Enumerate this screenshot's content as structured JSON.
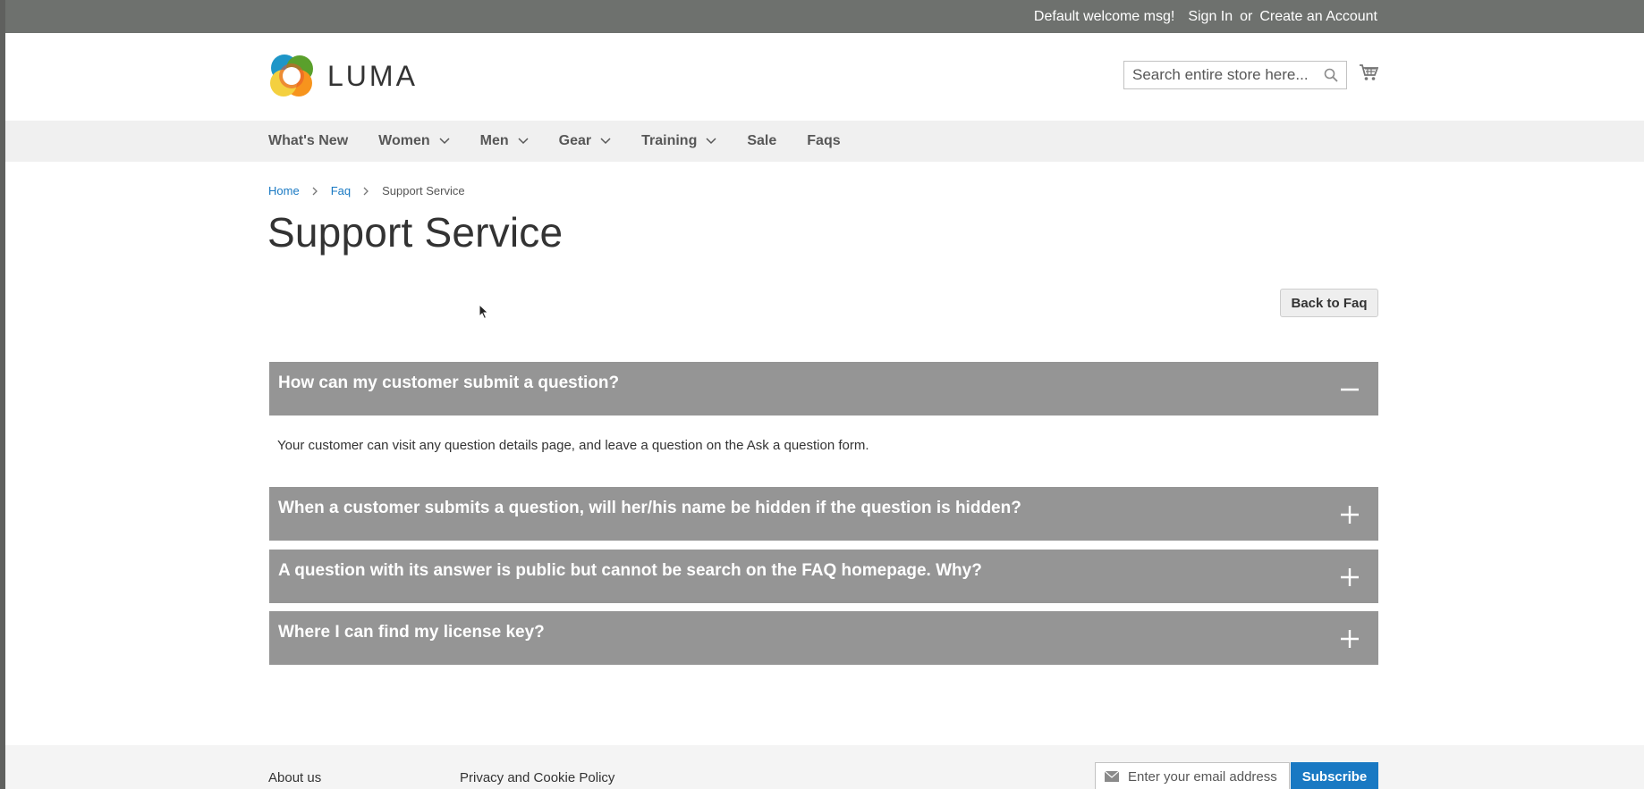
{
  "top_panel": {
    "welcome": "Default welcome msg!",
    "sign_in": "Sign In",
    "or": "or",
    "create_account": "Create an Account"
  },
  "header": {
    "logo_text": "LUMA",
    "search_placeholder": "Search entire store here...",
    "search_value": ""
  },
  "nav": {
    "items": [
      {
        "label": "What's New",
        "has_dropdown": false
      },
      {
        "label": "Women",
        "has_dropdown": true
      },
      {
        "label": "Men",
        "has_dropdown": true
      },
      {
        "label": "Gear",
        "has_dropdown": true
      },
      {
        "label": "Training",
        "has_dropdown": true
      },
      {
        "label": "Sale",
        "has_dropdown": false
      },
      {
        "label": "Faqs",
        "has_dropdown": false
      }
    ]
  },
  "breadcrumbs": {
    "home": "Home",
    "faq": "Faq",
    "current": "Support Service"
  },
  "page": {
    "title": "Support Service",
    "back_button": "Back to Faq"
  },
  "faqs": [
    {
      "question": "How can my customer submit a question?",
      "expanded": true,
      "answer": "Your customer can visit any question details page, and leave a question on the Ask a question form."
    },
    {
      "question": "When a customer submits a question, will her/his name be hidden if the question is hidden?",
      "expanded": false
    },
    {
      "question": "A question with its answer is public but cannot be search on the FAQ homepage. Why?",
      "expanded": false
    },
    {
      "question": "Where I can find my license key?",
      "expanded": false
    }
  ],
  "footer": {
    "about": "About us",
    "privacy": "Privacy and Cookie Policy",
    "newsletter_placeholder": "Enter your email address",
    "subscribe": "Subscribe"
  },
  "colors": {
    "top_panel": "#6e716e",
    "nav_bg": "#f0f0f0",
    "accordion_bg": "#959595",
    "link": "#1979c3",
    "subscribe_bg": "#1979c3"
  }
}
